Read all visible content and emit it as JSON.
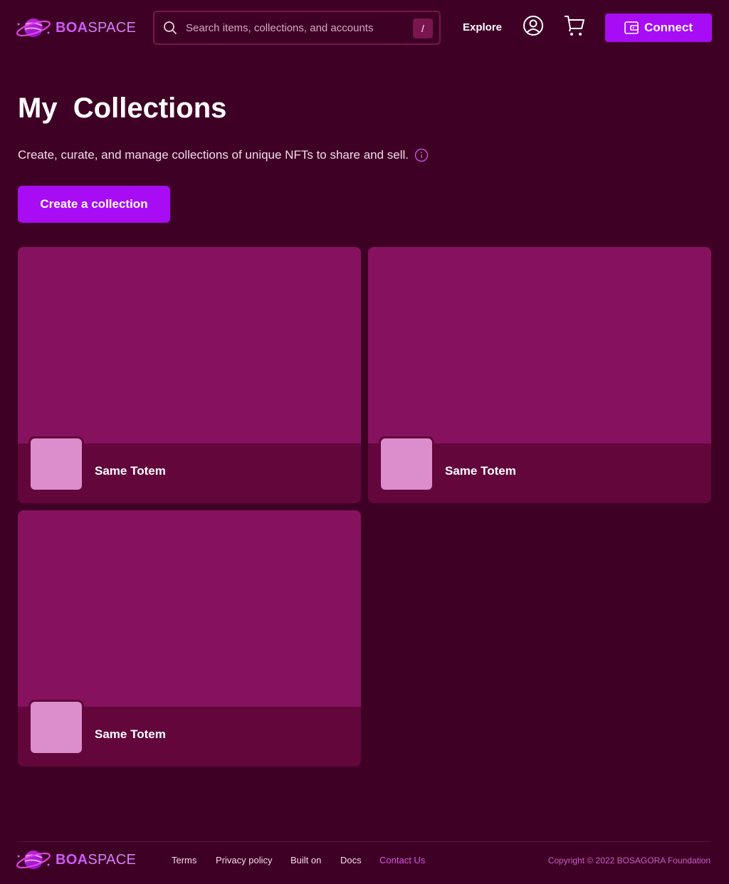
{
  "header": {
    "brand_bold": "BOA",
    "brand_light": "SPACE",
    "search_placeholder": "Search items, collections, and accounts",
    "search_shortcut": "/",
    "nav_explore": "Explore",
    "connect_label": "Connect"
  },
  "main": {
    "title": "My  Collections",
    "subtitle": "Create, curate, and manage collections of unique NFTs to share and sell.",
    "create_label": "Create a collection",
    "collections": [
      {
        "name": "Same Totem"
      },
      {
        "name": "Same Totem"
      },
      {
        "name": "Same Totem"
      }
    ]
  },
  "footer": {
    "brand_bold": "BOA",
    "brand_light": "SPACE",
    "links": [
      "Terms",
      "Privacy policy",
      "Built on",
      "Docs",
      "Contact Us"
    ],
    "copyright": "Copyright © 2022 BOSAGORA Foundation"
  },
  "colors": {
    "background": "#3f0025",
    "accent": "#a70cf5",
    "card_banner": "#86125f",
    "card_footer": "#63063c",
    "thumb": "#dc8dcc"
  },
  "icons": [
    "boaspace-logo-icon",
    "search-icon",
    "account-icon",
    "cart-icon",
    "wallet-icon",
    "info-icon"
  ]
}
